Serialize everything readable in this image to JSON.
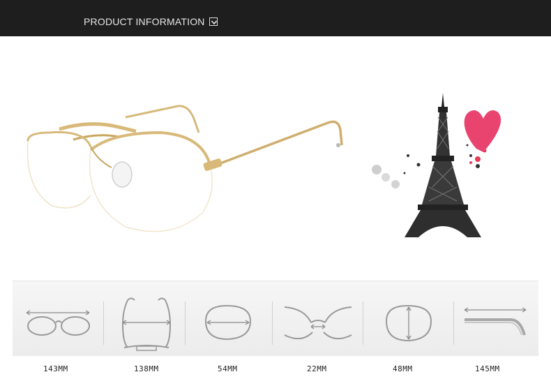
{
  "header": {
    "title": "PRODUCT INFORMATION",
    "dropdown_icon": "chevron-down-icon",
    "background": "#1e1e1e",
    "text_color": "#e6e6e6"
  },
  "hero": {
    "product_image": "gold-round-eyeglasses",
    "decoration_image": "eiffel-tower-with-pink-heart",
    "frame_color": "#d8b979",
    "heart_color": "#e8446f"
  },
  "measurements": [
    {
      "icon": "total-width-icon",
      "label": "143MM"
    },
    {
      "icon": "frame-height-icon",
      "label": "138MM"
    },
    {
      "icon": "lens-width-icon",
      "label": "54MM"
    },
    {
      "icon": "bridge-width-icon",
      "label": "22MM"
    },
    {
      "icon": "lens-height-icon",
      "label": "48MM"
    },
    {
      "icon": "temple-length-icon",
      "label": "145MM"
    }
  ]
}
